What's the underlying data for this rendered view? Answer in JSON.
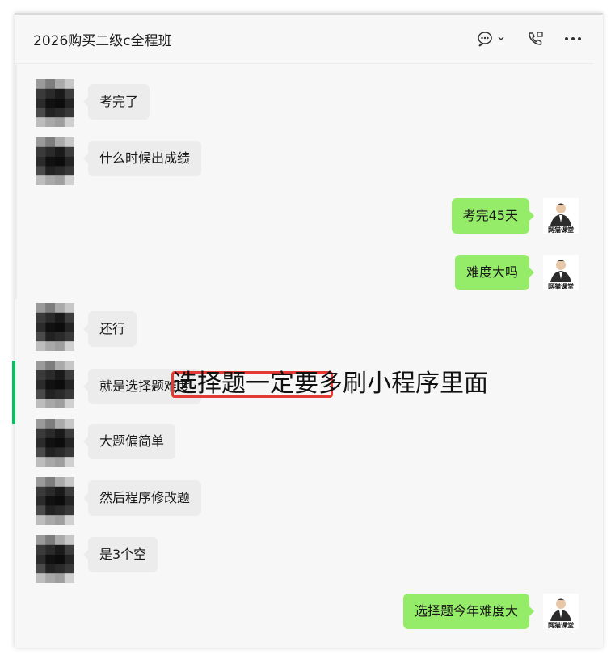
{
  "header": {
    "title": "2026购买二级c全程班"
  },
  "messages": [
    {
      "side": "in",
      "text": "考完了"
    },
    {
      "side": "in",
      "text": "什么时候出成绩"
    },
    {
      "side": "out",
      "text": "考完45天"
    },
    {
      "side": "out",
      "text": "难度大吗"
    },
    {
      "side": "in",
      "text": "还行"
    },
    {
      "side": "in",
      "text": "就是选择题难度"
    },
    {
      "side": "in",
      "text": "大题偏简单"
    },
    {
      "side": "in",
      "text": "然后程序修改题"
    },
    {
      "side": "in",
      "text": "是3个空"
    },
    {
      "side": "out",
      "text": "选择题今年难度大"
    }
  ],
  "overlay": {
    "caption": "选择题一定要多刷小程序里面"
  },
  "me_avatar": {
    "label": "网猫课堂"
  },
  "colors": {
    "out_bubble": "#95ec69",
    "in_bubble": "#ececec",
    "highlight": "#e53935",
    "marker": "#07c160"
  }
}
